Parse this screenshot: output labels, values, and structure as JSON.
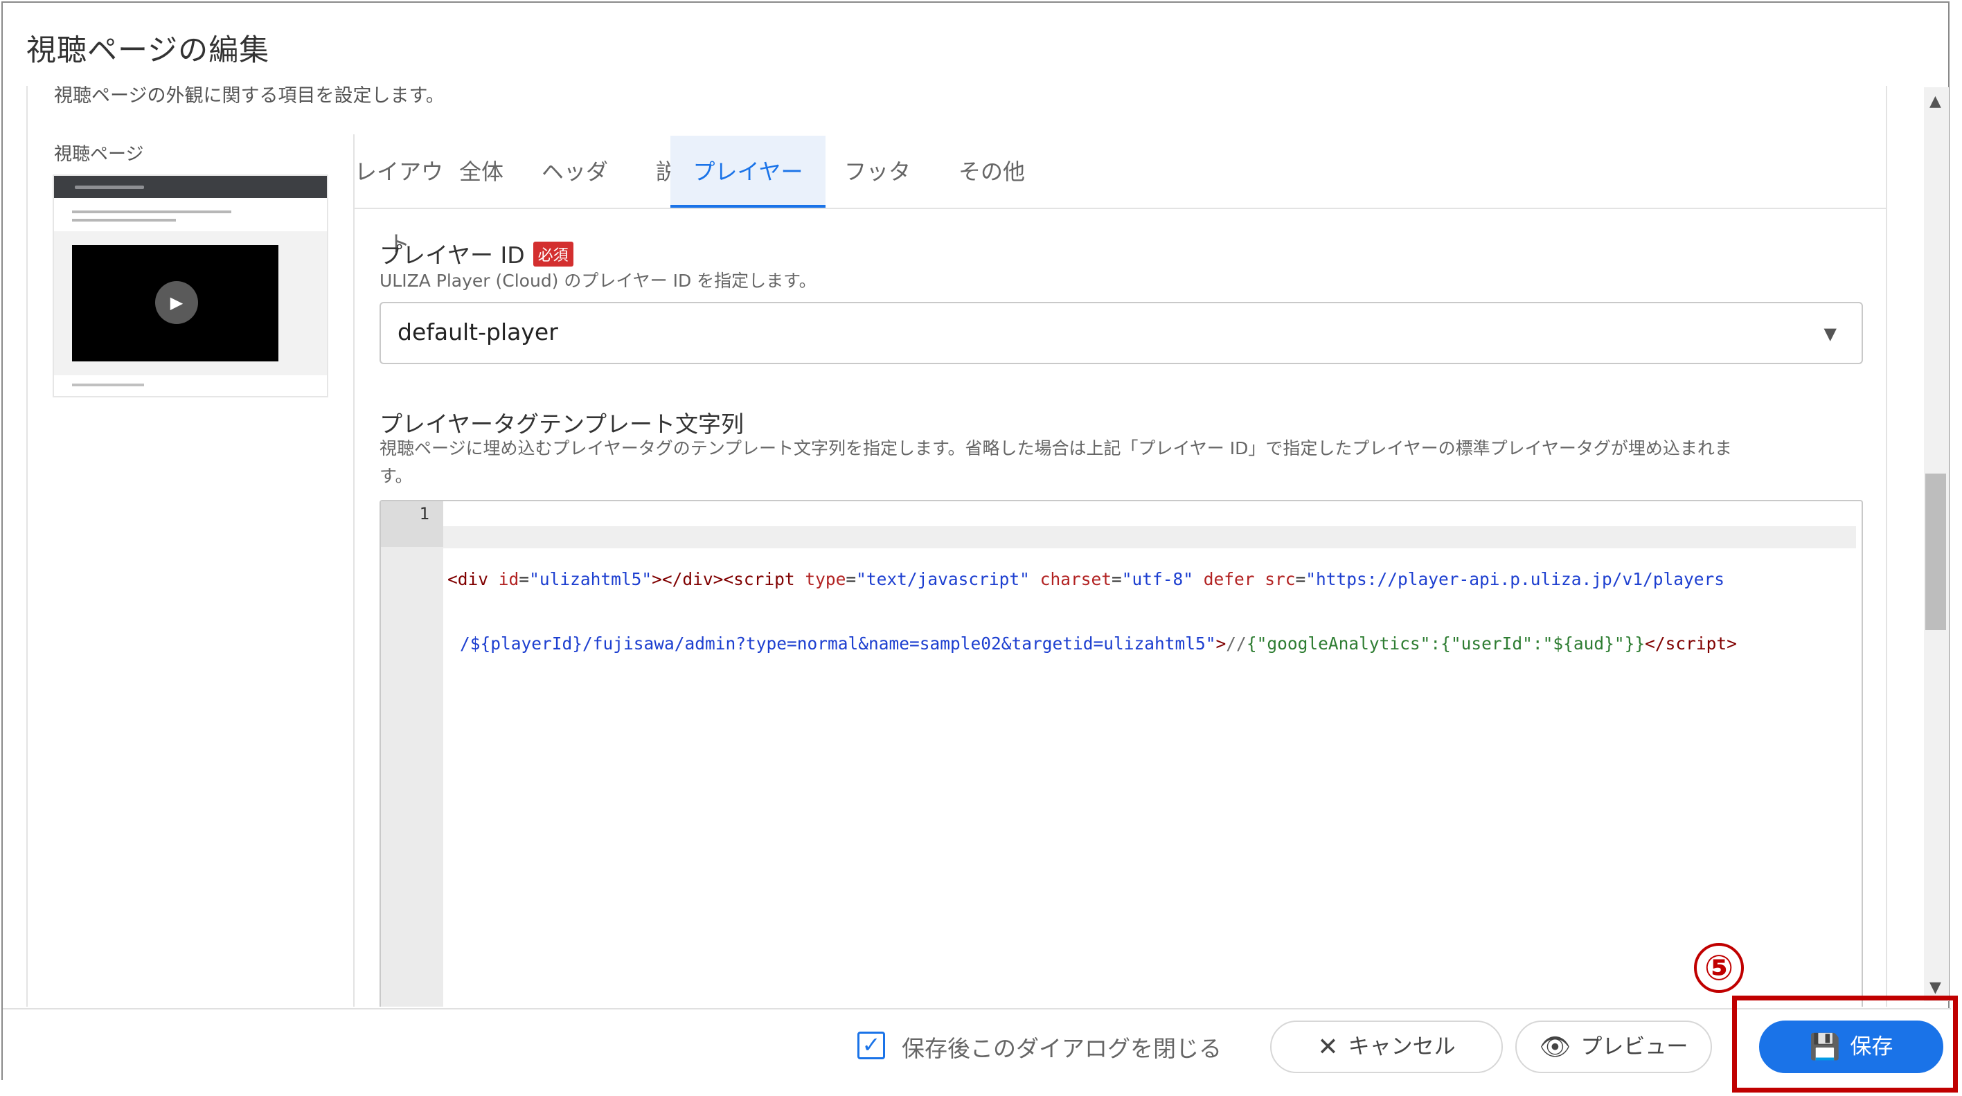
{
  "dialog": {
    "title": "視聴ページの編集",
    "section_description": "視聴ページの外観に関する項目を設定します。"
  },
  "preview": {
    "label": "視聴ページ",
    "play_icon": "play-icon"
  },
  "tabs": [
    {
      "label": "レイアウト",
      "active": false
    },
    {
      "label": "全体",
      "active": false
    },
    {
      "label": "ヘッダ",
      "active": false
    },
    {
      "label": "説明文",
      "active": false
    },
    {
      "label": "プレイヤー",
      "active": true
    },
    {
      "label": "フッタ",
      "active": false
    },
    {
      "label": "その他",
      "active": false
    }
  ],
  "player_id": {
    "label": "プレイヤー ID",
    "required_badge": "必須",
    "help": "ULIZA Player (Cloud) のプレイヤー ID を指定します。",
    "value": "default-player",
    "caret_icon": "caret-down-icon"
  },
  "template": {
    "label": "プレイヤータグテンプレート文字列",
    "help_line1": "視聴ページに埋め込むプレイヤータグのテンプレート文字列を指定します。省略した場合は上記「プレイヤー ID」で指定したプレイヤーの標準プレイヤータグが埋め込まれま",
    "help_line2": "す。",
    "line_number": "1",
    "code": {
      "lt1": "<",
      "div_open": "div",
      "id_attr": " id",
      "eq": "=",
      "id_val": "\"ulizahtml5\"",
      "gt_div_close": "></",
      "div_close": "div",
      "gt_lt": "><",
      "script": "script",
      "type_attr": " type",
      "type_val": "\"text/javascript\"",
      "charset_attr": " charset",
      "charset_val": "\"utf-8\"",
      "defer_attr": " defer",
      "src_attr": " src",
      "src_val_part1": "\"https://player-api.p.uliza.jp/v1/players",
      "src_val_part2": "/${playerId}/fujisawa/admin?type=normal&name=sample02&targetid=ulizahtml5\"",
      "gt": ">",
      "comment": "//",
      "json": "{\"googleAnalytics\":{\"userId\":\"${aud}\"}}",
      "end_lt": "</",
      "end_script": "script",
      "end_gt": ">"
    }
  },
  "footer": {
    "close_after_save_label": "保存後このダイアログを閉じる",
    "close_after_save_checked": true,
    "cancel_label": "キャンセル",
    "preview_label": "プレビュー",
    "save_label": "保存"
  },
  "annotation": {
    "step_number": "⑤"
  },
  "colors": {
    "accent": "#1a73e8",
    "required": "#d32f2f",
    "annotation": "#c00000"
  }
}
